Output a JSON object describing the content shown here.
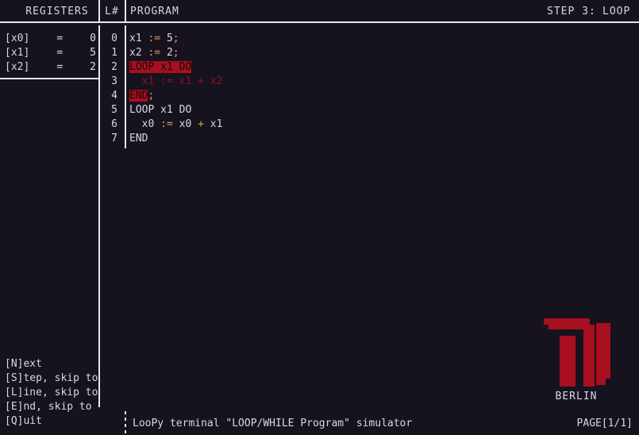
{
  "app": {
    "status_text": "LooPy terminal \"LOOP/WHILE Program\" simulator",
    "page_indicator": "PAGE[1/1]"
  },
  "header": {
    "registers_label": "REGISTERS",
    "lineno_label": "L#",
    "program_label": "PROGRAM",
    "step_label": "STEP 3:",
    "step_mode": "LOOP"
  },
  "registers": {
    "rows": [
      {
        "name": "[x0]",
        "eq": "=",
        "value": "0"
      },
      {
        "name": "[x1]",
        "eq": "=",
        "value": "5"
      },
      {
        "name": "[x2]",
        "eq": "=",
        "value": "2"
      }
    ]
  },
  "program": {
    "line_numbers": [
      "0",
      "1",
      "2",
      "3",
      "4",
      "5",
      "6",
      "7"
    ],
    "lines": [
      {
        "n": "0",
        "text": "x1 := 5;",
        "state": "normal"
      },
      {
        "n": "1",
        "text": "x2 := 2;",
        "state": "normal"
      },
      {
        "n": "2",
        "text": "LOOP x1 DO",
        "state": "highlight"
      },
      {
        "n": "3",
        "text": "  x1 := x1 + x2",
        "state": "dim"
      },
      {
        "n": "4",
        "text": "END;",
        "state": "highlight-partial"
      },
      {
        "n": "5",
        "text": "LOOP x1 DO",
        "state": "normal"
      },
      {
        "n": "6",
        "text": "  x0 := x0 + x1",
        "state": "normal"
      },
      {
        "n": "7",
        "text": "END",
        "state": "normal"
      }
    ],
    "segments": [
      [
        {
          "t": "x1",
          "c": "var"
        },
        {
          "t": " ",
          "c": "plain"
        },
        {
          "t": ":=",
          "c": "op"
        },
        {
          "t": " ",
          "c": "plain"
        },
        {
          "t": "5",
          "c": "num"
        },
        {
          "t": ";",
          "c": "op"
        }
      ],
      [
        {
          "t": "x2",
          "c": "var"
        },
        {
          "t": " ",
          "c": "plain"
        },
        {
          "t": ":=",
          "c": "op"
        },
        {
          "t": " ",
          "c": "plain"
        },
        {
          "t": "2",
          "c": "num"
        },
        {
          "t": ";",
          "c": "op"
        }
      ],
      [
        {
          "t": "LOOP x1 DO",
          "c": "hl"
        }
      ],
      [
        {
          "t": "  x1 := x1 + x2",
          "c": "dim"
        }
      ],
      [
        {
          "t": "END",
          "c": "hl"
        },
        {
          "t": ";",
          "c": "op"
        }
      ],
      [
        {
          "t": "LOOP",
          "c": "kw"
        },
        {
          "t": " x1 ",
          "c": "var"
        },
        {
          "t": "DO",
          "c": "kw"
        }
      ],
      [
        {
          "t": "  ",
          "c": "plain"
        },
        {
          "t": "x0",
          "c": "var"
        },
        {
          "t": " ",
          "c": "plain"
        },
        {
          "t": ":=",
          "c": "op"
        },
        {
          "t": " ",
          "c": "plain"
        },
        {
          "t": "x0",
          "c": "var"
        },
        {
          "t": " ",
          "c": "plain"
        },
        {
          "t": "+",
          "c": "op"
        },
        {
          "t": " ",
          "c": "plain"
        },
        {
          "t": "x1",
          "c": "var"
        }
      ],
      [
        {
          "t": "END",
          "c": "kw"
        }
      ]
    ]
  },
  "menu": {
    "items": [
      "[N]ext",
      "[S]tep, skip to",
      "[L]ine, skip to",
      "[E]nd, skip to",
      "[Q]uit"
    ]
  },
  "logo": {
    "caption": "BERLIN",
    "name": "tu-berlin-logo"
  },
  "colors": {
    "background": "#16131f",
    "foreground": "#d9d6e8",
    "accent_red": "#a8101f",
    "dim_red": "#8e1320",
    "operator_orange": "#e09a5a",
    "rule": "#e8e4f2"
  }
}
